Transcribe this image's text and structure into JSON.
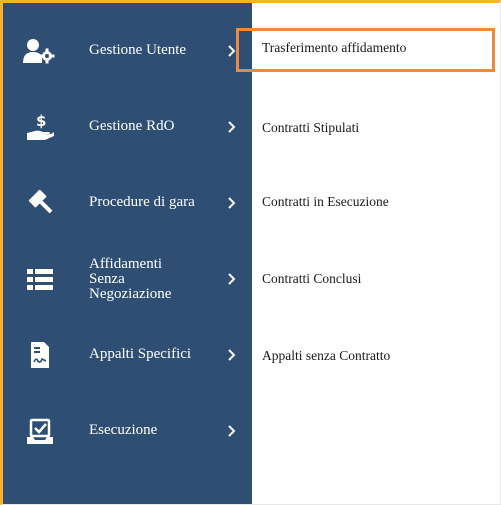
{
  "sidebar": {
    "items": [
      {
        "label": "Gestione Utente",
        "icon": "users-gear-icon"
      },
      {
        "label": "Gestione RdO",
        "icon": "hand-money-icon"
      },
      {
        "label": "Procedure di gara",
        "icon": "gavel-icon"
      },
      {
        "label": "Affidamenti\nSenza\nNegoziazione",
        "icon": "list-icon"
      },
      {
        "label": "Appalti Specifici",
        "icon": "document-signature-icon"
      },
      {
        "label": "Esecuzione",
        "icon": "tray-check-icon"
      }
    ]
  },
  "submenu": {
    "items": [
      {
        "label": "Trasferimento affidamento",
        "highlighted": true
      },
      {
        "label": "Contratti Stipulati"
      },
      {
        "label": "Contratti in Esecuzione"
      },
      {
        "label": "Contratti Conclusi"
      },
      {
        "label": "Appalti senza Contratto"
      }
    ]
  },
  "colors": {
    "sidebar_bg": "#2e4f73",
    "highlight_border": "#ee8a3d",
    "frame_border": "#f5b331"
  }
}
